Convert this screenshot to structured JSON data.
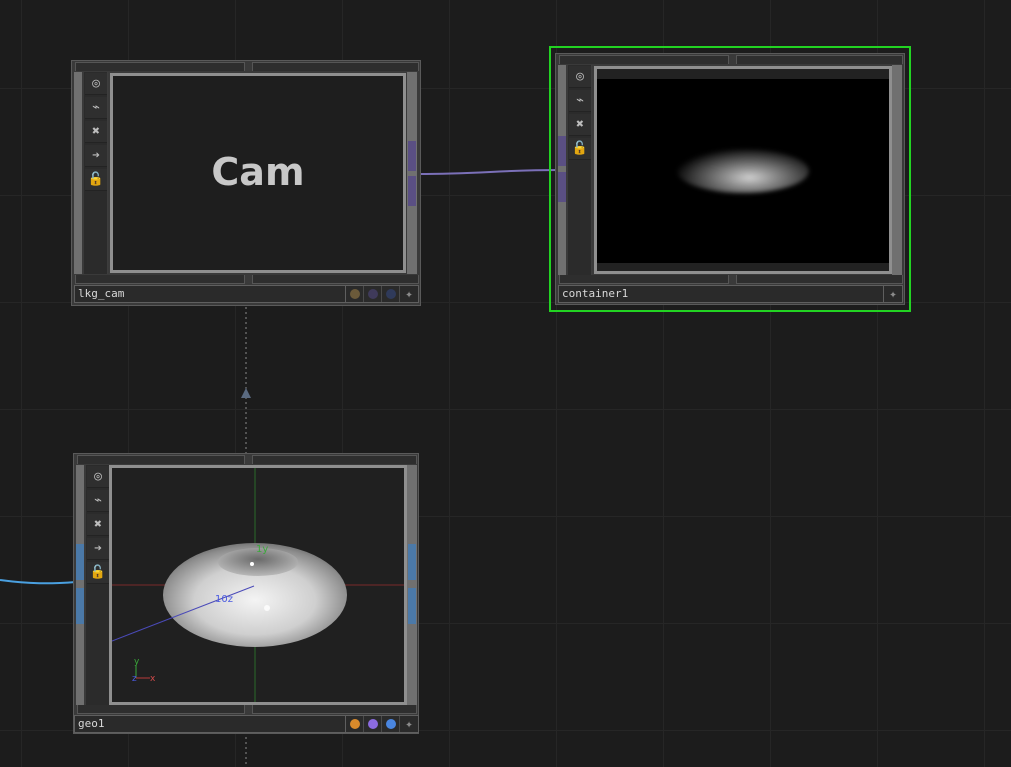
{
  "nodes": {
    "cam": {
      "name": "lkg_cam",
      "viewer_text": "Cam",
      "flags": [
        "viewer-icon",
        "bypass-icon",
        "close-icon",
        "arrow-right-icon",
        "lock-icon"
      ],
      "dots": [
        "#6b5a3a",
        "#3f3a5a",
        "#2f3a5a"
      ]
    },
    "container": {
      "name": "container1",
      "flags": [
        "viewer-icon",
        "bypass-icon",
        "close-icon",
        "lock-icon"
      ],
      "selected_color": "#22d322"
    },
    "geo": {
      "name": "geo1",
      "flags": [
        "viewer-icon",
        "bypass-icon",
        "close-icon",
        "arrow-right-icon",
        "lock-icon"
      ],
      "dots": [
        "#d98a2b",
        "#8b6be0",
        "#4a86e0"
      ],
      "axis_y_label": "1y",
      "axis_z_label": "10z",
      "gizmo_y": "y",
      "gizmo_z": "z",
      "gizmo_x": "x"
    }
  },
  "icons": {
    "viewer-icon": "◎",
    "bypass-icon": "⌁",
    "close-icon": "✖",
    "arrow-right-icon": "➔",
    "lock-icon": "🔓",
    "plus-icon": "✦"
  },
  "colors": {
    "background": "#1c1c1c",
    "wire_purple": "#7b70b8",
    "wire_blue": "#4aa0e0",
    "selected_border": "#22d322"
  }
}
